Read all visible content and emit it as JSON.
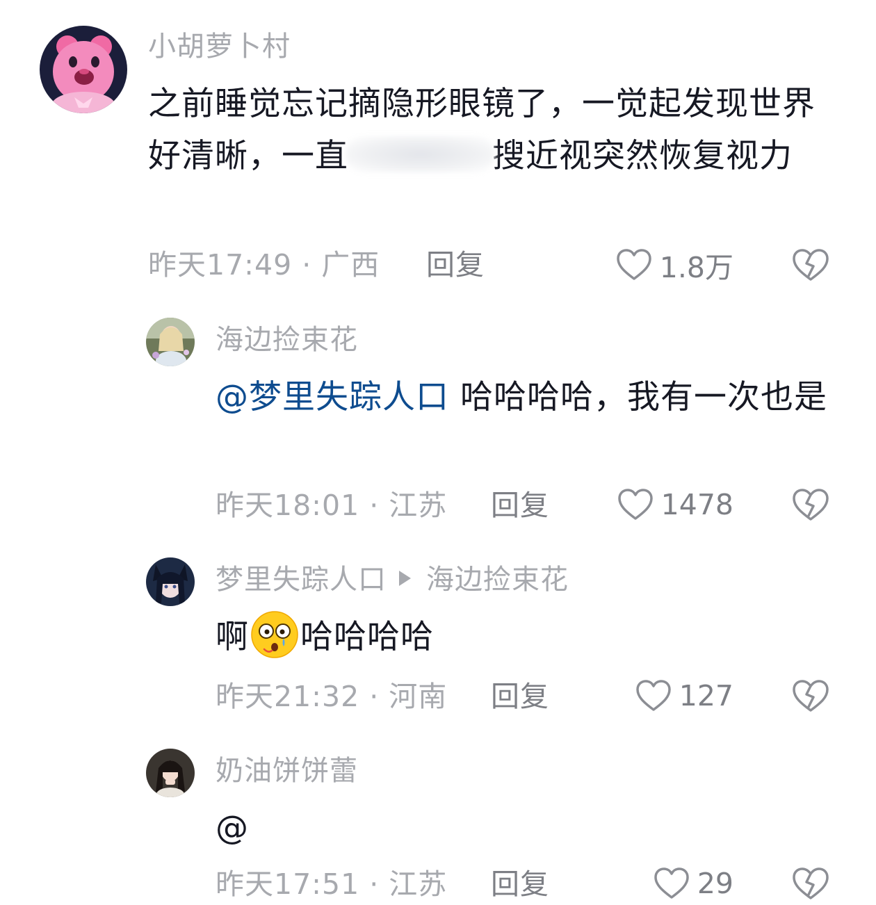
{
  "comments": [
    {
      "username": "小胡萝卜村",
      "text_before_blur": "之前睡觉忘记摘隐形眼镜了，一觉起发现世界好清晰，一直",
      "text_after_blur": "搜近视突然恢复视力",
      "time": "昨天17:49",
      "location": "广西",
      "reply_label": "回复",
      "likes": "1.8万"
    },
    {
      "username": "海边捡束花",
      "mention": "@梦里失踪人口",
      "text": " 哈哈哈哈，我有一次也是",
      "time": "昨天18:01",
      "location": "江苏",
      "reply_label": "回复",
      "likes": "1478"
    },
    {
      "username": "梦里失踪人口",
      "reply_to": "海边捡束花",
      "text_before_emoji": "啊",
      "text_after_emoji": "哈哈哈哈",
      "emoji": "astonished-face-emoji",
      "time": "昨天21:32",
      "location": "河南",
      "reply_label": "回复",
      "likes": "127"
    },
    {
      "username": "奶油饼饼蕾",
      "text": "@",
      "time": "昨天17:51",
      "location": "江苏",
      "reply_label": "回复",
      "likes": "29"
    }
  ],
  "separator": " · ",
  "icons": {
    "like": "heart-outline-icon",
    "dislike": "broken-heart-icon"
  },
  "colors": {
    "text": "#161823",
    "muted": "#a7a9ae",
    "action": "#7d7f85",
    "mention": "#0e4c8f"
  }
}
